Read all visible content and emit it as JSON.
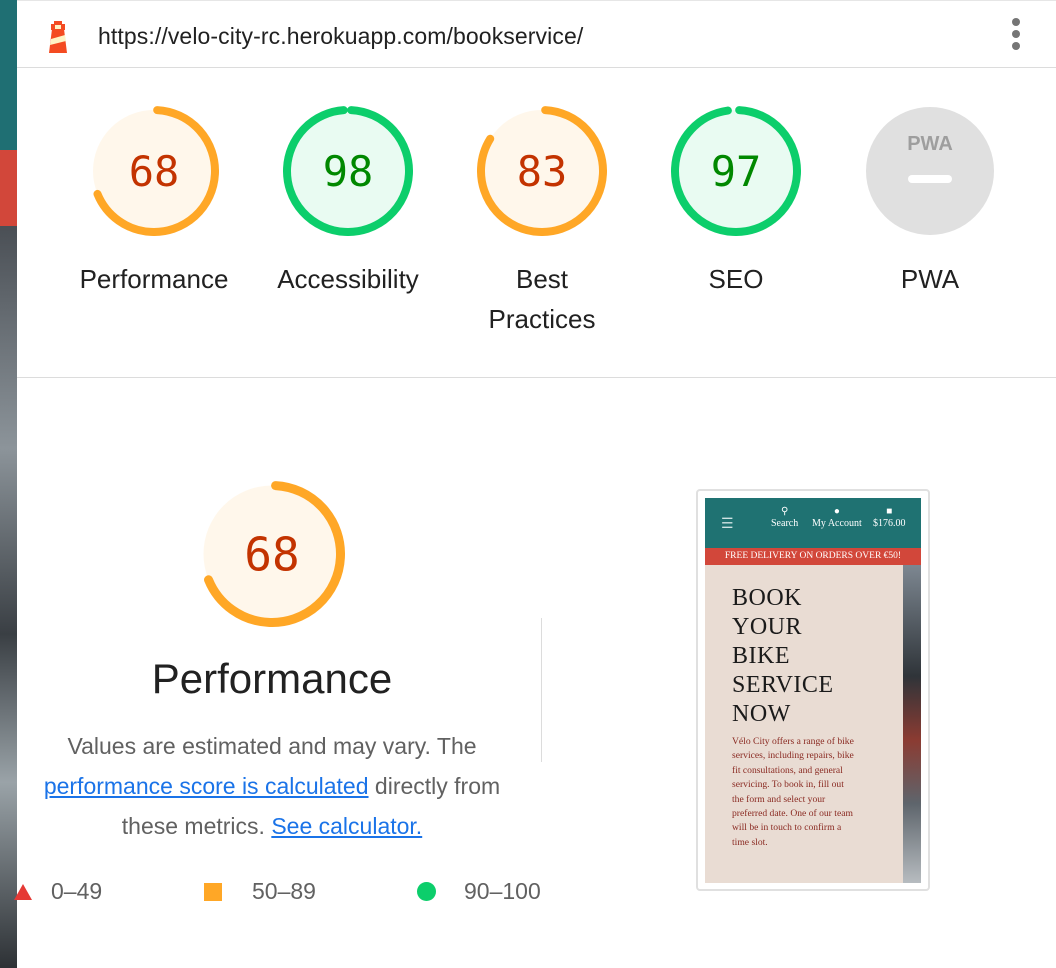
{
  "browser": {
    "url": "https://velo-city-rc.herokuapp.com/bookservice/",
    "menu_icon": "kebab-menu-icon",
    "logo_icon": "lighthouse-icon"
  },
  "colors": {
    "pass": "#0cce6b",
    "average": "#ffa726",
    "fail": "#e53935",
    "pass_text": "#008800",
    "average_text": "#c33300",
    "link": "#1a73e8"
  },
  "gauges": [
    {
      "score": "68",
      "label": "Performance",
      "rating": "average"
    },
    {
      "score": "98",
      "label": "Accessibility",
      "rating": "pass"
    },
    {
      "score": "83",
      "label": "Best Practices",
      "rating": "average"
    },
    {
      "score": "97",
      "label": "SEO",
      "rating": "pass"
    },
    {
      "score": "PWA",
      "label": "PWA",
      "rating": "na"
    }
  ],
  "performance": {
    "score": "68",
    "title": "Performance",
    "desc_prefix": "Values are estimated and may vary. The",
    "link1": "performance score is calculated",
    "desc_middle": "directly from these metrics.",
    "link2": "See calculator."
  },
  "legend": [
    {
      "range": "0–49",
      "shape": "triangle"
    },
    {
      "range": "50–89",
      "shape": "square"
    },
    {
      "range": "90–100",
      "shape": "circle"
    }
  ],
  "thumbnail": {
    "nav": {
      "search": "Search",
      "account": "My Account",
      "bag": "$176.00"
    },
    "banner": "FREE DELIVERY ON ORDERS OVER €50!",
    "heading": [
      "BOOK",
      "YOUR",
      "BIKE",
      "SERVICE",
      "NOW"
    ],
    "body": "Vélo City offers a range of bike services, including repairs, bike fit consultations, and general servicing. To book in, fill out the form and select your preferred date. One of our team will be in touch to confirm a time slot."
  }
}
